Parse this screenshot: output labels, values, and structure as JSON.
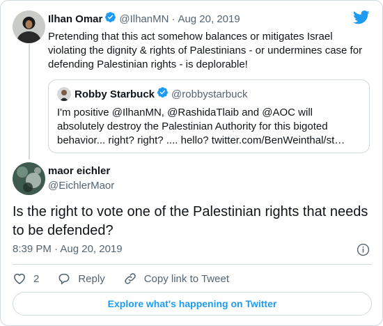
{
  "parent_tweet": {
    "author_name": "Ilhan Omar",
    "author_handle": "@IlhanMN",
    "separator": "·",
    "date": "Aug 20, 2019",
    "text": "Pretending that this act somehow balances or mitigates Israel violating the dignity & rights of Palestinians - or undermines case for defending Palestinian rights - is deplorable!",
    "quoted_tweet": {
      "author_name": "Robby Starbuck",
      "author_handle": "@robbystarbuck",
      "text": "I'm positive @IlhanMN, @RashidaTlaib and @AOC will absolutely destroy the Palestinian Authority for this bigoted behavior... right? right? .... hello? twitter.com/BenWeinthal/st…"
    }
  },
  "main_tweet": {
    "author_name": "maor eichler",
    "author_handle": "@EichlerMaor",
    "text": "Is the right to vote one of the Palestinian rights that needs to be defended?",
    "timestamp": "8:39 PM · Aug 20, 2019"
  },
  "actions": {
    "like_count": "2",
    "reply_label": "Reply",
    "copy_link_label": "Copy link to Tweet"
  },
  "explore_label": "Explore what's happening on Twitter",
  "colors": {
    "accent": "#1d9bf0",
    "secondary_text": "#536471",
    "border": "#cfd9de"
  },
  "icons": [
    "twitter-bird-icon",
    "verified-badge-icon",
    "info-icon",
    "heart-icon",
    "reply-icon",
    "link-icon"
  ]
}
